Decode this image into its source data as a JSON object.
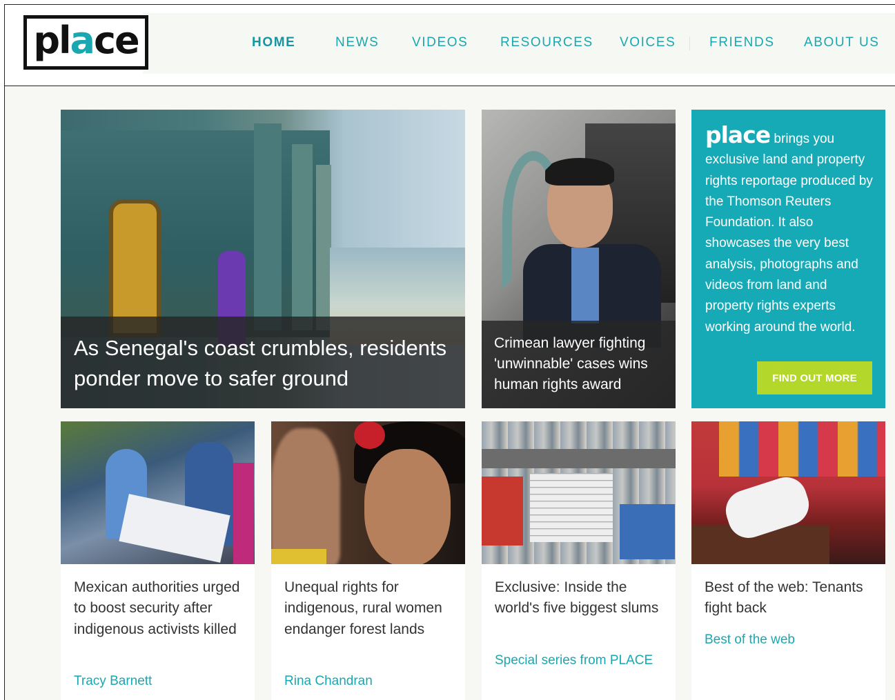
{
  "header": {
    "logo_text_p": "pl",
    "logo_text_o": "a",
    "logo_text_rest": "ce",
    "nav": [
      {
        "label": "HOME",
        "active": true
      },
      {
        "label": "NEWS",
        "active": false
      },
      {
        "label": "VIDEOS",
        "active": false
      },
      {
        "label": "RESOURCES",
        "active": false
      },
      {
        "label": "VOICES",
        "active": false
      },
      {
        "label": "FRIENDS",
        "active": false
      },
      {
        "label": "ABOUT US",
        "active": false
      }
    ]
  },
  "features": {
    "main": {
      "title": "As Senegal's coast crumbles, residents ponder move to safer ground"
    },
    "secondary": {
      "title": "Crimean lawyer fighting 'unwinnable' cases wins human rights award"
    }
  },
  "info": {
    "brand": "place",
    "text": " brings you exclusive land and property rights reportage produced by the Thomson Reuters Foundation. It also showcases the very best analysis, photographs and videos from land and property rights experts working around the world.",
    "button": "FIND OUT MORE"
  },
  "cards": [
    {
      "title": "Mexican authorities urged to boost security after indigenous activists killed",
      "meta": "Tracy Barnett"
    },
    {
      "title": "Unequal rights for indigenous, rural women endanger forest lands",
      "meta": "Rina Chandran"
    },
    {
      "title": "Exclusive: Inside the world's five biggest slums",
      "meta": "Special series from PLACE"
    },
    {
      "title": "Best of the web: Tenants fight back",
      "meta": "Best of the web"
    }
  ],
  "colors": {
    "accent": "#1aa7b0",
    "info_bg": "#16a9b6",
    "button_bg": "#b3d82b"
  }
}
